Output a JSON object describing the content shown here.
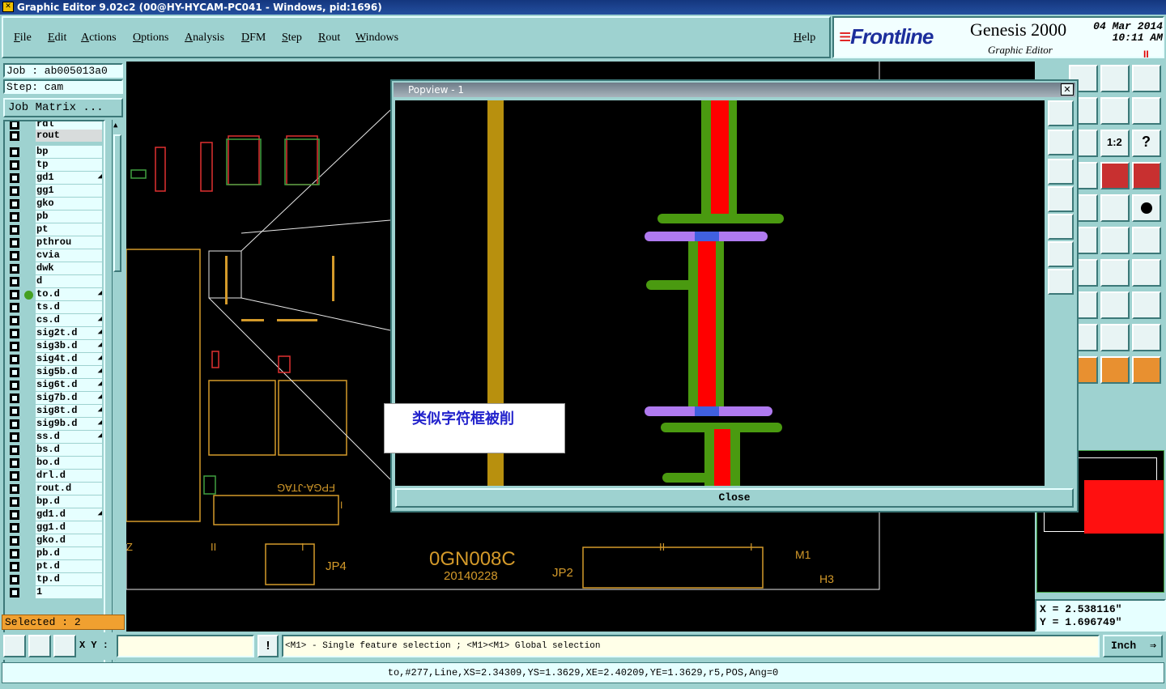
{
  "window": {
    "title": "Graphic Editor 9.02c2 (00@HY-HYCAM-PC041 - Windows, pid:1696)"
  },
  "menu": [
    "File",
    "Edit",
    "Actions",
    "Options",
    "Analysis",
    "DFM",
    "Step",
    "Rout",
    "Windows",
    "Help"
  ],
  "brand": {
    "logo": "Frontline",
    "product": "Genesis 2000",
    "subtitle": "Graphic Editor",
    "date": "04 Mar 2014",
    "time": "10:11 AM",
    "pause": "II"
  },
  "job": {
    "label": "Job : ab005013a0",
    "step": "Step: cam",
    "matrix_button": "Job Matrix ..."
  },
  "layers": [
    {
      "name": "rdl",
      "gray": false,
      "mark": ""
    },
    {
      "name": "rout",
      "gray": true,
      "mark": ""
    },
    {
      "name": "bp",
      "gray": false,
      "mark": ""
    },
    {
      "name": "tp",
      "gray": false,
      "mark": ""
    },
    {
      "name": "gd1",
      "gray": false,
      "mark": "◢"
    },
    {
      "name": "gg1",
      "gray": false,
      "mark": ""
    },
    {
      "name": "gko",
      "gray": false,
      "mark": ""
    },
    {
      "name": "pb",
      "gray": false,
      "mark": ""
    },
    {
      "name": "pt",
      "gray": false,
      "mark": ""
    },
    {
      "name": "pthrou",
      "gray": false,
      "mark": ""
    },
    {
      "name": "cvia",
      "gray": false,
      "mark": ""
    },
    {
      "name": "dwk",
      "gray": false,
      "mark": ""
    },
    {
      "name": "d",
      "gray": false,
      "mark": ""
    },
    {
      "name": "to.d",
      "gray": false,
      "mark": "◢",
      "active": true
    },
    {
      "name": "ts.d",
      "gray": false,
      "mark": ""
    },
    {
      "name": "cs.d",
      "gray": false,
      "mark": "◢"
    },
    {
      "name": "sig2t.d",
      "gray": false,
      "mark": "◢"
    },
    {
      "name": "sig3b.d",
      "gray": false,
      "mark": "◢"
    },
    {
      "name": "sig4t.d",
      "gray": false,
      "mark": "◢"
    },
    {
      "name": "sig5b.d",
      "gray": false,
      "mark": "◢"
    },
    {
      "name": "sig6t.d",
      "gray": false,
      "mark": "◢"
    },
    {
      "name": "sig7b.d",
      "gray": false,
      "mark": "◢"
    },
    {
      "name": "sig8t.d",
      "gray": false,
      "mark": "◢"
    },
    {
      "name": "sig9b.d",
      "gray": false,
      "mark": "◢"
    },
    {
      "name": "ss.d",
      "gray": false,
      "mark": "◢"
    },
    {
      "name": "bs.d",
      "gray": false,
      "mark": ""
    },
    {
      "name": "bo.d",
      "gray": false,
      "mark": ""
    },
    {
      "name": "drl.d",
      "gray": false,
      "mark": ""
    },
    {
      "name": "rout.d",
      "gray": false,
      "mark": ""
    },
    {
      "name": "bp.d",
      "gray": false,
      "mark": ""
    },
    {
      "name": "gd1.d",
      "gray": false,
      "mark": "◢"
    },
    {
      "name": "gg1.d",
      "gray": false,
      "mark": ""
    },
    {
      "name": "gko.d",
      "gray": false,
      "mark": ""
    },
    {
      "name": "pb.d",
      "gray": false,
      "mark": ""
    },
    {
      "name": "pt.d",
      "gray": false,
      "mark": ""
    },
    {
      "name": "tp.d",
      "gray": false,
      "mark": ""
    },
    {
      "name": "1",
      "gray": false,
      "mark": ""
    }
  ],
  "selected": "Selected : 2",
  "popview": {
    "title": "Popview - 1",
    "close": "Close",
    "close_x": "✕"
  },
  "annotation": "类似字符框被削",
  "board_text": {
    "part": "0GN008C",
    "date": "20140228",
    "jp4": "JP4",
    "jp2": "JP2",
    "m1": "M1",
    "h3": "H3",
    "fpga": "FPGA-JTAG",
    "z": "Z",
    "ii1": "II",
    "i1": "I",
    "ii2": "II",
    "i2": "I",
    "i3": "I"
  },
  "coords": {
    "x": "X = 2.538116\"",
    "y": "Y = 1.696749\""
  },
  "cmd": {
    "xy_label": "X Y :",
    "xy_value": "",
    "hint": "<M1> - Single feature selection ; <M1><M1> Global selection",
    "units": "Inch",
    "bang": "!"
  },
  "status": "to,#277,Line,XS=2.34309,YS=1.3629,XE=2.40209,YE=1.3629,r5,POS,Ang=0"
}
